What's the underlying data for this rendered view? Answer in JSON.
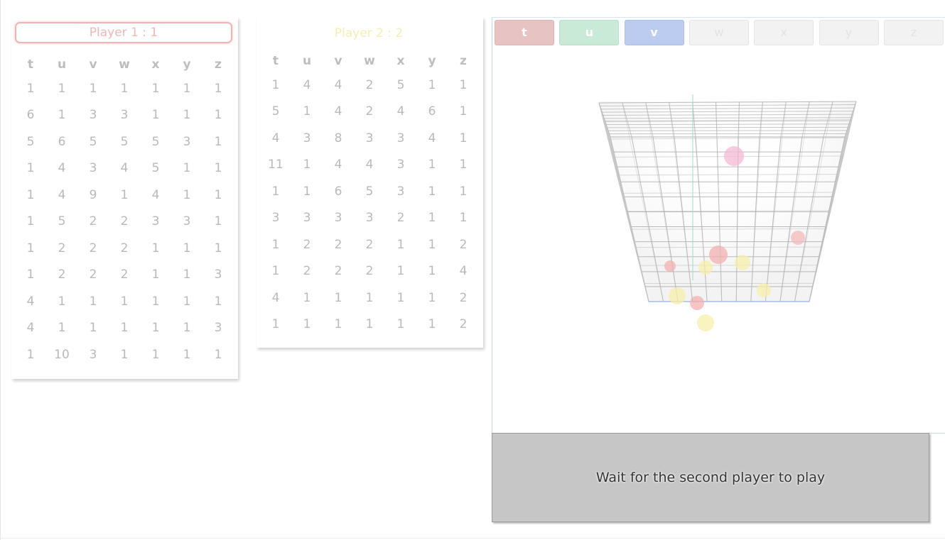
{
  "player1": {
    "title": "Player 1 : 1",
    "headers": [
      "t",
      "u",
      "v",
      "w",
      "x",
      "y",
      "z"
    ],
    "rows": [
      [
        "1",
        "1",
        "1",
        "1",
        "1",
        "1",
        "1"
      ],
      [
        "6",
        "1",
        "3",
        "3",
        "1",
        "1",
        "1"
      ],
      [
        "5",
        "6",
        "5",
        "5",
        "5",
        "3",
        "1"
      ],
      [
        "1",
        "4",
        "3",
        "4",
        "5",
        "1",
        "1"
      ],
      [
        "1",
        "4",
        "9",
        "1",
        "4",
        "1",
        "1"
      ],
      [
        "1",
        "5",
        "2",
        "2",
        "3",
        "3",
        "1"
      ],
      [
        "1",
        "2",
        "2",
        "2",
        "1",
        "1",
        "1"
      ],
      [
        "1",
        "2",
        "2",
        "2",
        "1",
        "1",
        "3"
      ],
      [
        "4",
        "1",
        "1",
        "1",
        "1",
        "1",
        "1"
      ],
      [
        "4",
        "1",
        "1",
        "1",
        "1",
        "1",
        "3"
      ],
      [
        "1",
        "10",
        "3",
        "1",
        "1",
        "1",
        "1"
      ]
    ]
  },
  "player2": {
    "title": "Player 2 : 2",
    "headers": [
      "t",
      "u",
      "v",
      "w",
      "x",
      "y",
      "z"
    ],
    "rows": [
      [
        "1",
        "4",
        "4",
        "2",
        "5",
        "1",
        "1"
      ],
      [
        "5",
        "1",
        "4",
        "2",
        "4",
        "6",
        "1"
      ],
      [
        "4",
        "3",
        "8",
        "3",
        "3",
        "4",
        "1"
      ],
      [
        "11",
        "1",
        "4",
        "4",
        "3",
        "1",
        "1"
      ],
      [
        "1",
        "1",
        "6",
        "5",
        "3",
        "1",
        "1"
      ],
      [
        "3",
        "3",
        "3",
        "3",
        "2",
        "1",
        "1"
      ],
      [
        "1",
        "2",
        "2",
        "2",
        "1",
        "1",
        "2"
      ],
      [
        "1",
        "2",
        "2",
        "2",
        "1",
        "1",
        "4"
      ],
      [
        "4",
        "1",
        "1",
        "1",
        "1",
        "1",
        "2"
      ],
      [
        "1",
        "1",
        "1",
        "1",
        "1",
        "1",
        "2"
      ]
    ]
  },
  "dimension_buttons": [
    {
      "label": "t",
      "color": "#e8c3c3",
      "active": true
    },
    {
      "label": "u",
      "color": "#c9ead7",
      "active": true
    },
    {
      "label": "v",
      "color": "#bccbf0",
      "active": true
    },
    {
      "label": "w",
      "color": "#f2f2f2",
      "active": false
    },
    {
      "label": "x",
      "color": "#f2f2f2",
      "active": false
    },
    {
      "label": "y",
      "color": "#f2f2f2",
      "active": false
    },
    {
      "label": "z",
      "color": "#f2f2f2",
      "active": false
    }
  ],
  "status_message": "Wait for the second player to play",
  "colors": {
    "player1_accent": "#f2b3b3",
    "player2_accent": "#f4efb0",
    "status_bg": "#c6c6c6"
  }
}
